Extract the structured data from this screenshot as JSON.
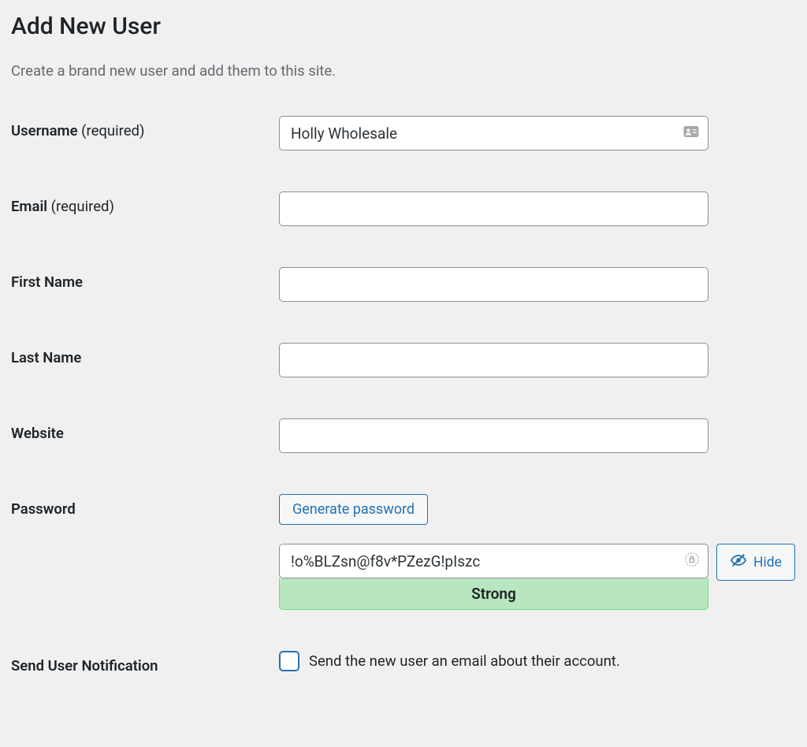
{
  "page": {
    "title": "Add New User",
    "description": "Create a brand new user and add them to this site."
  },
  "fields": {
    "username": {
      "label": "Username ",
      "required_label": "(required)",
      "value": "Holly Wholesale"
    },
    "email": {
      "label": "Email ",
      "required_label": "(required)",
      "value": ""
    },
    "first_name": {
      "label": "First Name",
      "value": ""
    },
    "last_name": {
      "label": "Last Name",
      "value": ""
    },
    "website": {
      "label": "Website",
      "value": ""
    },
    "password": {
      "label": "Password",
      "generate_label": "Generate password",
      "value": "!o%BLZsn@f8v*PZezG!pIszc",
      "strength_label": "Strong",
      "hide_label": "Hide"
    },
    "notification": {
      "label": "Send User Notification",
      "checkbox_label": "Send the new user an email about their account."
    }
  },
  "colors": {
    "primary": "#2271b1",
    "strong_bg": "#b8e6bf",
    "strong_border": "#68de7c"
  }
}
